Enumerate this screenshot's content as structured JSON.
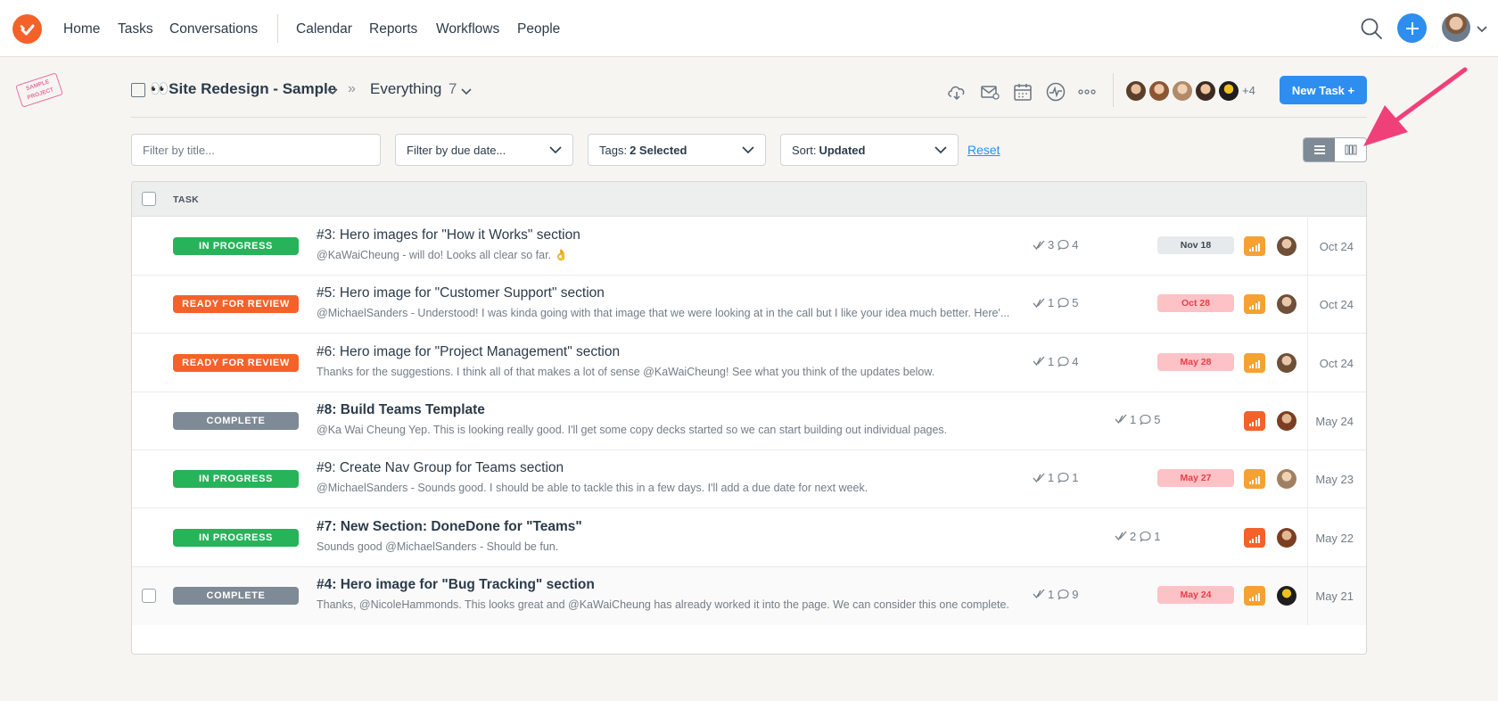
{
  "nav": {
    "links": [
      "Home",
      "Tasks",
      "Conversations",
      "Calendar",
      "Reports",
      "Workflows",
      "People"
    ]
  },
  "stamp": "SAMPLE PROJECT",
  "project": {
    "title": "👀Site Redesign - Sample",
    "view": "Everything",
    "count": "7",
    "more_members": "+4",
    "new_task_label": "New Task +"
  },
  "filters": {
    "title_placeholder": "Filter by title...",
    "due": "Filter by due date...",
    "tags_label": "Tags:",
    "tags_value": "2 Selected",
    "sort_label": "Sort:",
    "sort_value": "Updated",
    "reset": "Reset"
  },
  "table": {
    "header": "TASK",
    "rows": [
      {
        "status": "IN PROGRESS",
        "status_color": "#27b35a",
        "title": "#3: Hero images for \"How it Works\" section",
        "snippet": "@KaWaiCheung - will do! Looks all clear so far. 👌",
        "checks": "3",
        "comments": "4",
        "due": "Nov 18",
        "due_style": "neutral",
        "priority_color": "#f5a233",
        "updated": "Oct 24",
        "bold": false
      },
      {
        "status": "READY FOR REVIEW",
        "status_color": "#f4622a",
        "title": "#5: Hero image for \"Customer Support\" section",
        "snippet": "@MichaelSanders - Understood! I was kinda going with that image that we were looking at in the call but I like your idea much better. Here'...",
        "checks": "1",
        "comments": "5",
        "due": "Oct 28",
        "due_style": "overdue",
        "priority_color": "#f5a233",
        "updated": "Oct 24",
        "bold": false
      },
      {
        "status": "READY FOR REVIEW",
        "status_color": "#f4622a",
        "title": "#6: Hero image for \"Project Management\" section",
        "snippet": "Thanks for the suggestions. I think all of that makes a lot of sense @KaWaiCheung! See what you think of the updates below.",
        "checks": "1",
        "comments": "4",
        "due": "May 28",
        "due_style": "overdue",
        "priority_color": "#f5a233",
        "updated": "Oct 24",
        "bold": false
      },
      {
        "status": "COMPLETE",
        "status_color": "#7e8a95",
        "title": "#8: Build Teams Template",
        "snippet": "@Ka Wai Cheung Yep. This is looking really good. I'll get some copy decks started so we can start building out individual pages.",
        "checks": "1",
        "comments": "5",
        "due": "",
        "due_style": "none",
        "priority_color": "#f4622a",
        "updated": "May 24",
        "bold": true
      },
      {
        "status": "IN PROGRESS",
        "status_color": "#27b35a",
        "title": "#9: Create Nav Group for Teams section",
        "snippet": "@MichaelSanders - Sounds good. I should be able to tackle this in a few days. I'll add a due date for next week.",
        "checks": "1",
        "comments": "1",
        "due": "May 27",
        "due_style": "overdue",
        "priority_color": "#f5a233",
        "updated": "May 23",
        "bold": false
      },
      {
        "status": "IN PROGRESS",
        "status_color": "#27b35a",
        "title": "#7: New Section: DoneDone for \"Teams\"",
        "snippet": "Sounds good @MichaelSanders - Should be fun.",
        "checks": "2",
        "comments": "1",
        "due": "",
        "due_style": "none",
        "priority_color": "#f4622a",
        "updated": "May 22",
        "bold": true
      },
      {
        "status": "COMPLETE",
        "status_color": "#7e8a95",
        "title": "#4: Hero image for \"Bug Tracking\" section",
        "snippet": "Thanks, @NicoleHammonds. This looks great and @KaWaiCheung has already worked it into the page. We can consider this one complete.",
        "checks": "1",
        "comments": "9",
        "due": "May 24",
        "due_style": "overdue",
        "priority_color": "#f5a233",
        "updated": "May 21",
        "bold": true
      }
    ]
  },
  "colors": {
    "accent": "#2d8ef0",
    "brand": "#f4622a",
    "arrow": "#f0407a"
  }
}
